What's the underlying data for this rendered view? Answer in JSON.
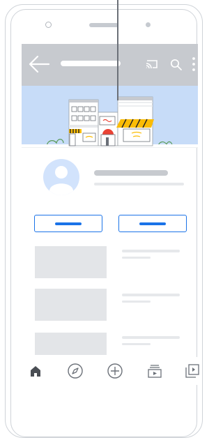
{
  "device": {
    "frame_color": "#cfd3d8",
    "notch": [
      "camera",
      "speaker",
      "sensor"
    ]
  },
  "appbar": {
    "background": "#c7cacf",
    "icons": [
      "back-arrow-icon",
      "cast-icon",
      "search-icon",
      "more-vert-icon"
    ],
    "title_placeholder": ""
  },
  "channel": {
    "banner_color": "#c7dcf8",
    "avatar_color": "#d2e3fc"
  },
  "actions": {
    "accent": "#1a73e8",
    "buttons": [
      "button-one",
      "button-two"
    ]
  },
  "videos": {
    "rows": 3
  },
  "bottom_nav": {
    "items": [
      "home-icon",
      "explore-icon",
      "create-icon",
      "subscriptions-icon",
      "library-icon"
    ],
    "selected": "home-icon"
  }
}
